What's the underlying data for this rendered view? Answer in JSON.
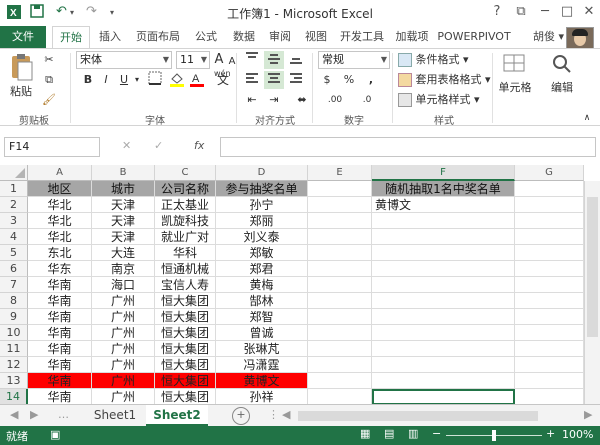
{
  "window": {
    "title": "工作簿1 - Microsoft Excel",
    "buttons": {
      "help": "?",
      "restore": "⧉",
      "minimize": "─",
      "maximize": "□",
      "close": "✕"
    }
  },
  "quick_access": {
    "save_icon": "save-icon",
    "undo_icon": "undo-icon",
    "redo_icon": "redo-icon",
    "customize_icon": "customize-icon"
  },
  "tabs": [
    "文件",
    "开始",
    "插入",
    "页面布局",
    "公式",
    "数据",
    "审阅",
    "视图",
    "开发工具",
    "加载项",
    "POWERPIVOT"
  ],
  "active_tab": "开始",
  "user": {
    "name": "胡俊 ▾"
  },
  "ribbon": {
    "clipboard": {
      "paste": "粘贴",
      "label": "剪贴板"
    },
    "font": {
      "name": "宋体",
      "size": "11",
      "bold": "B",
      "italic": "I",
      "underline": "U",
      "grow": "A",
      "shrink": "A",
      "label": "字体",
      "wen": "wén"
    },
    "alignment": {
      "label": "对齐方式"
    },
    "number": {
      "format": "常规",
      "percent": "%",
      "comma": ",",
      "currency": "$",
      "inc": ".00",
      "dec": ".0",
      "label": "数字"
    },
    "styles": {
      "conditional": "条件格式 ▾",
      "table": "套用表格格式 ▾",
      "cell": "单元格样式 ▾",
      "label": "样式"
    },
    "cells": {
      "label": "单元格"
    },
    "editing": {
      "label": "编辑"
    }
  },
  "formula_bar": {
    "name_box": "F14",
    "fx": "fx",
    "cancel": "✕",
    "enter": "✓",
    "value": ""
  },
  "columns": [
    "A",
    "B",
    "C",
    "D",
    "E",
    "F",
    "G"
  ],
  "rows": [
    "1",
    "2",
    "3",
    "4",
    "5",
    "6",
    "7",
    "8",
    "9",
    "10",
    "11",
    "12",
    "13",
    "14"
  ],
  "table": {
    "header": [
      "地区",
      "城市",
      "公司名称",
      "参与抽奖名单"
    ],
    "data": [
      [
        "华北",
        "天津",
        "正太基业",
        "孙宁"
      ],
      [
        "华北",
        "天津",
        "凯旋科技",
        "郑丽"
      ],
      [
        "华北",
        "天津",
        "就业广对",
        "刘义泰"
      ],
      [
        "东北",
        "大连",
        "华科",
        "郑敏"
      ],
      [
        "华东",
        "南京",
        "恒通机械",
        "郑君"
      ],
      [
        "华南",
        "海口",
        "宝信人寿",
        "黄梅"
      ],
      [
        "华南",
        "广州",
        "恒大集团",
        "郜林"
      ],
      [
        "华南",
        "广州",
        "恒大集团",
        "郑智"
      ],
      [
        "华南",
        "广州",
        "恒大集团",
        "曾诚"
      ],
      [
        "华南",
        "广州",
        "恒大集团",
        "张琳芃"
      ],
      [
        "华南",
        "广州",
        "恒大集团",
        "冯潇霆"
      ],
      [
        "华南",
        "广州",
        "恒大集团",
        "黄博文"
      ],
      [
        "华南",
        "广州",
        "恒大集团",
        "孙祥"
      ]
    ],
    "highlight_row": 13,
    "highlight_color": "#ff0000",
    "header_color": "#a6a6a6"
  },
  "winner": {
    "header": "随机抽取1名中奖名单",
    "value": "黄博文"
  },
  "selected_cell": "F14",
  "sheets": [
    "Sheet1",
    "Sheet2"
  ],
  "active_sheet": "Sheet2",
  "status": {
    "mode": "就绪",
    "zoom": "100%",
    "minus": "−",
    "plus": "+"
  },
  "accent": "#217346"
}
